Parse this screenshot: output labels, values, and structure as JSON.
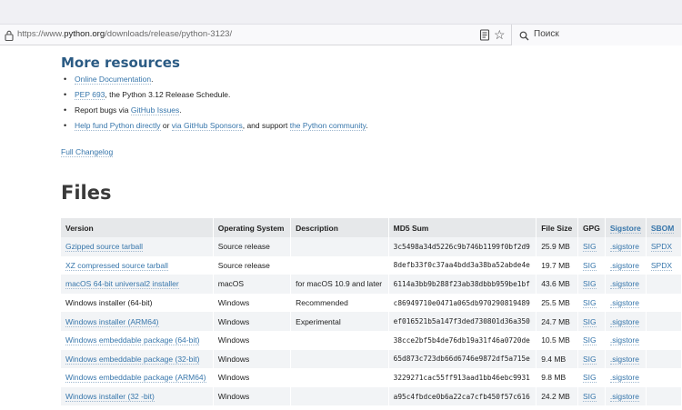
{
  "browser": {
    "url_prefix": "https://www.",
    "url_host": "python.org",
    "url_path": "/downloads/release/python-3123/",
    "search_placeholder": "Поиск"
  },
  "resources": {
    "heading": "More resources",
    "items": [
      {
        "link": "Online Documentation",
        "after": "."
      },
      {
        "link": "PEP 693",
        "after": ", the Python 3.12 Release Schedule."
      },
      {
        "before": "Report bugs via ",
        "link": "GitHub Issues",
        "after": "."
      },
      {
        "link": "Help fund Python directly",
        "mid": " or ",
        "link2": "via GitHub Sponsors",
        "mid2": ", and support ",
        "link3": "the Python community",
        "after": "."
      }
    ],
    "changelog": "Full Changelog"
  },
  "files": {
    "heading": "Files",
    "columns": [
      "Version",
      "Operating System",
      "Description",
      "MD5 Sum",
      "File Size",
      "GPG",
      "Sigstore",
      "SBOM"
    ],
    "rows": [
      {
        "version": "Gzipped source tarball",
        "version_link": true,
        "os": "Source release",
        "desc": "",
        "md5": "3c5498a34d5226c9b746b1199f0bf2d9",
        "size": "25.9 MB",
        "gpg": "SIG",
        "sigstore": ".sigstore",
        "sbom": "SPDX"
      },
      {
        "version": "XZ compressed source tarball",
        "version_link": true,
        "os": "Source release",
        "desc": "",
        "md5": "8defb33f0c37aa4bdd3a38ba52abde4e",
        "size": "19.7 MB",
        "gpg": "SIG",
        "sigstore": ".sigstore",
        "sbom": "SPDX"
      },
      {
        "version": "macOS 64-bit universal2 installer",
        "version_link": true,
        "os": "macOS",
        "desc": "for macOS 10.9 and later",
        "md5": "6114a3bb9b288f23ab38dbbb959be1bf",
        "size": "43.6 MB",
        "gpg": "SIG",
        "sigstore": ".sigstore",
        "sbom": ""
      },
      {
        "version": "Windows installer (64-bit)",
        "version_link": false,
        "os": "Windows",
        "desc": "Recommended",
        "md5": "c86949710e0471a065db970290819489",
        "size": "25.5 MB",
        "gpg": "SIG",
        "sigstore": ".sigstore",
        "sbom": ""
      },
      {
        "version": "Windows installer (ARM64)",
        "version_link": true,
        "os": "Windows",
        "desc": "Experimental",
        "md5": "ef016521b5a147f3ded730801d36a350",
        "size": "24.7 MB",
        "gpg": "SIG",
        "sigstore": ".sigstore",
        "sbom": ""
      },
      {
        "version": "Windows embeddable package (64-bit)",
        "version_link": true,
        "os": "Windows",
        "desc": "",
        "md5": "38cce2bf5b4de76db19a31f46a0720de",
        "size": "10.5 MB",
        "gpg": "SIG",
        "sigstore": ".sigstore",
        "sbom": ""
      },
      {
        "version": "Windows embeddable package (32-bit)",
        "version_link": true,
        "os": "Windows",
        "desc": "",
        "md5": "65d873c723db66d6746e9872df5a715e",
        "size": "9.4 MB",
        "gpg": "SIG",
        "sigstore": ".sigstore",
        "sbom": ""
      },
      {
        "version": "Windows embeddable package (ARM64)",
        "version_link": true,
        "os": "Windows",
        "desc": "",
        "md5": "3229271cac55ff913aad1bb46ebc9931",
        "size": "9.8 MB",
        "gpg": "SIG",
        "sigstore": ".sigstore",
        "sbom": ""
      },
      {
        "version": "Windows installer (32 -bit)",
        "version_link": true,
        "os": "Windows",
        "desc": "",
        "md5": "a95c4fbdce0b6a22ca7cfb450f57c616",
        "size": "24.2 MB",
        "gpg": "SIG",
        "sigstore": ".sigstore",
        "sbom": ""
      }
    ]
  },
  "colors": {
    "link": "#3776ab",
    "heading": "#2b5b84",
    "header_bg": "#e6e8ea",
    "row_alt": "#f2f4f6"
  },
  "icons": [
    "lock-icon",
    "reader-view-icon",
    "bookmark-star-icon",
    "search-icon"
  ]
}
